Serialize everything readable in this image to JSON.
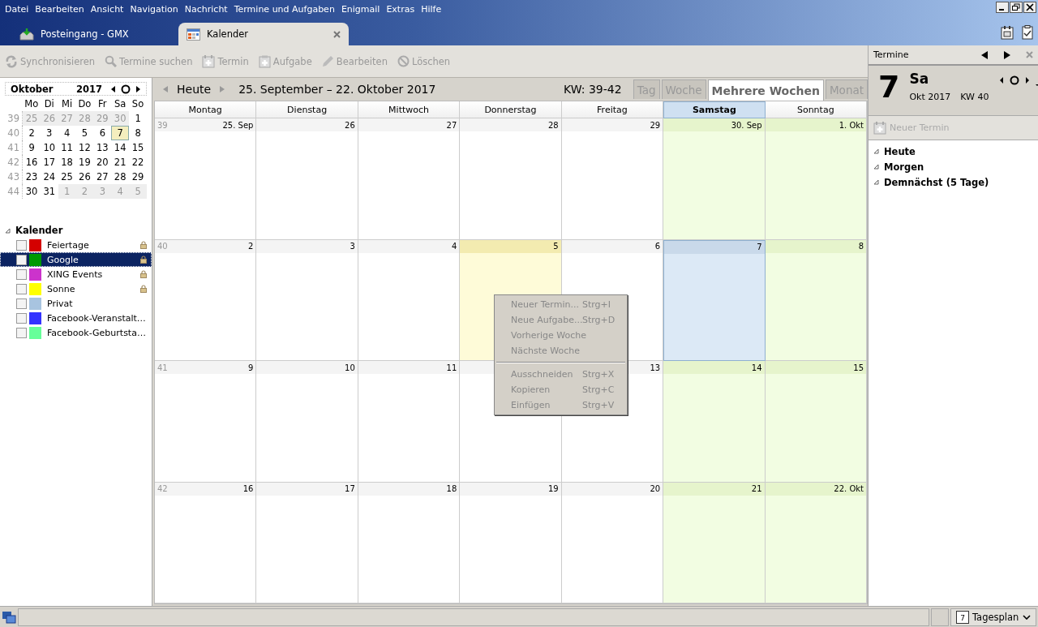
{
  "menu_bar": [
    "Datei",
    "Bearbeiten",
    "Ansicht",
    "Navigation",
    "Nachricht",
    "Termine und Aufgaben",
    "Enigmail",
    "Extras",
    "Hilfe"
  ],
  "app_tabs": [
    {
      "label": "Posteingang - GMX",
      "kind": "mail",
      "selected": false,
      "closable": false
    },
    {
      "label": "Kalender",
      "kind": "calendar",
      "selected": true,
      "closable": true
    }
  ],
  "toolbar": [
    {
      "label": "Synchronisieren",
      "kind": "sync",
      "disabled": true
    },
    {
      "label": "Termine suchen",
      "kind": "search",
      "disabled": true
    },
    {
      "label": "Termin",
      "kind": "event",
      "disabled": true
    },
    {
      "label": "Aufgabe",
      "kind": "task",
      "disabled": true
    },
    {
      "label": "Bearbeiten",
      "kind": "edit",
      "disabled": true
    },
    {
      "label": "Löschen",
      "kind": "delete",
      "disabled": true
    }
  ],
  "mini_calendar": {
    "month": "Oktober",
    "year": "2017",
    "weekdays": [
      "Mo",
      "Di",
      "Mi",
      "Do",
      "Fr",
      "Sa",
      "So"
    ],
    "weeks": [
      {
        "number": "39",
        "days": [
          {
            "label": "25",
            "other_month": true,
            "selected": false
          },
          {
            "label": "26",
            "other_month": true,
            "selected": false
          },
          {
            "label": "27",
            "other_month": true,
            "selected": false
          },
          {
            "label": "28",
            "other_month": true,
            "selected": false
          },
          {
            "label": "29",
            "other_month": true,
            "selected": false
          },
          {
            "label": "30",
            "other_month": true,
            "selected": false
          },
          {
            "label": "1",
            "other_month": false,
            "selected": false
          }
        ]
      },
      {
        "number": "40",
        "days": [
          {
            "label": "2",
            "other_month": false,
            "selected": false
          },
          {
            "label": "3",
            "other_month": false,
            "selected": false
          },
          {
            "label": "4",
            "other_month": false,
            "selected": false
          },
          {
            "label": "5",
            "other_month": false,
            "selected": false
          },
          {
            "label": "6",
            "other_month": false,
            "selected": false
          },
          {
            "label": "7",
            "other_month": false,
            "selected": true
          },
          {
            "label": "8",
            "other_month": false,
            "selected": false
          }
        ]
      },
      {
        "number": "41",
        "days": [
          {
            "label": "9",
            "other_month": false,
            "selected": false
          },
          {
            "label": "10",
            "other_month": false,
            "selected": false
          },
          {
            "label": "11",
            "other_month": false,
            "selected": false
          },
          {
            "label": "12",
            "other_month": false,
            "selected": false
          },
          {
            "label": "13",
            "other_month": false,
            "selected": false
          },
          {
            "label": "14",
            "other_month": false,
            "selected": false
          },
          {
            "label": "15",
            "other_month": false,
            "selected": false
          }
        ]
      },
      {
        "number": "42",
        "days": [
          {
            "label": "16",
            "other_month": false,
            "selected": false
          },
          {
            "label": "17",
            "other_month": false,
            "selected": false
          },
          {
            "label": "18",
            "other_month": false,
            "selected": false
          },
          {
            "label": "19",
            "other_month": false,
            "selected": false
          },
          {
            "label": "20",
            "other_month": false,
            "selected": false
          },
          {
            "label": "21",
            "other_month": false,
            "selected": false
          },
          {
            "label": "22",
            "other_month": false,
            "selected": false
          }
        ]
      },
      {
        "number": "43",
        "days": [
          {
            "label": "23",
            "other_month": false,
            "selected": false
          },
          {
            "label": "24",
            "other_month": false,
            "selected": false
          },
          {
            "label": "25",
            "other_month": false,
            "selected": false
          },
          {
            "label": "26",
            "other_month": false,
            "selected": false
          },
          {
            "label": "27",
            "other_month": false,
            "selected": false
          },
          {
            "label": "28",
            "other_month": false,
            "selected": false
          },
          {
            "label": "29",
            "other_month": false,
            "selected": false
          }
        ]
      },
      {
        "number": "44",
        "days": [
          {
            "label": "30",
            "other_month": false,
            "selected": false
          },
          {
            "label": "31",
            "other_month": false,
            "selected": false
          },
          {
            "label": "1",
            "other_month": true,
            "selected": false
          },
          {
            "label": "2",
            "other_month": true,
            "selected": false
          },
          {
            "label": "3",
            "other_month": true,
            "selected": false
          },
          {
            "label": "4",
            "other_month": true,
            "selected": false
          },
          {
            "label": "5",
            "other_month": true,
            "selected": false
          }
        ]
      }
    ]
  },
  "calendars": {
    "title": "Kalender",
    "expanded": true,
    "items": [
      {
        "name": "Feiertage",
        "color": "#d40000",
        "checked": false,
        "locked": true,
        "selected": false
      },
      {
        "name": "Google",
        "color": "#009900",
        "checked": false,
        "locked": true,
        "selected": true
      },
      {
        "name": "XING Events",
        "color": "#cc33cc",
        "checked": false,
        "locked": true,
        "selected": false
      },
      {
        "name": "Sonne",
        "color": "#ffff00",
        "checked": false,
        "locked": true,
        "selected": false
      },
      {
        "name": "Privat",
        "color": "#a8c4e0",
        "checked": false,
        "locked": false,
        "selected": false
      },
      {
        "name": "Facebook-Veranstalt…",
        "color": "#3333ff",
        "checked": false,
        "locked": false,
        "selected": false
      },
      {
        "name": "Facebook-Geburtsta…",
        "color": "#66ff99",
        "checked": false,
        "locked": false,
        "selected": false
      }
    ]
  },
  "view_header": {
    "today_button": "Heute",
    "range": "25. September – 22. Oktober 2017",
    "week_range": "KW: 39-42",
    "view_tabs": [
      {
        "label": "Tag",
        "selected": false
      },
      {
        "label": "Woche",
        "selected": false
      },
      {
        "label": "Mehrere Wochen",
        "selected": true
      },
      {
        "label": "Monat",
        "selected": false
      }
    ]
  },
  "day_columns": [
    {
      "label": "Montag",
      "selected": false
    },
    {
      "label": "Dienstag",
      "selected": false
    },
    {
      "label": "Mittwoch",
      "selected": false
    },
    {
      "label": "Donnerstag",
      "selected": false
    },
    {
      "label": "Freitag",
      "selected": false
    },
    {
      "label": "Samstag",
      "selected": true
    },
    {
      "label": "Sonntag",
      "selected": false
    }
  ],
  "weeks": [
    {
      "number": "39",
      "days": [
        {
          "label": "25. Sep",
          "weekend": false,
          "today": false,
          "selected": false
        },
        {
          "label": "26",
          "weekend": false,
          "today": false,
          "selected": false
        },
        {
          "label": "27",
          "weekend": false,
          "today": false,
          "selected": false
        },
        {
          "label": "28",
          "weekend": false,
          "today": false,
          "selected": false
        },
        {
          "label": "29",
          "weekend": false,
          "today": false,
          "selected": false
        },
        {
          "label": "30. Sep",
          "weekend": true,
          "today": false,
          "selected": false
        },
        {
          "label": "1. Okt",
          "weekend": true,
          "today": false,
          "selected": false
        }
      ]
    },
    {
      "number": "40",
      "days": [
        {
          "label": "2",
          "weekend": false,
          "today": false,
          "selected": false
        },
        {
          "label": "3",
          "weekend": false,
          "today": false,
          "selected": false
        },
        {
          "label": "4",
          "weekend": false,
          "today": false,
          "selected": false
        },
        {
          "label": "5",
          "weekend": false,
          "today": false,
          "selected": true
        },
        {
          "label": "6",
          "weekend": false,
          "today": false,
          "selected": false
        },
        {
          "label": "7",
          "weekend": true,
          "today": true,
          "selected": false
        },
        {
          "label": "8",
          "weekend": true,
          "today": false,
          "selected": false
        }
      ]
    },
    {
      "number": "41",
      "days": [
        {
          "label": "9",
          "weekend": false,
          "today": false,
          "selected": false
        },
        {
          "label": "10",
          "weekend": false,
          "today": false,
          "selected": false
        },
        {
          "label": "11",
          "weekend": false,
          "today": false,
          "selected": false
        },
        {
          "weekend": false,
          "today": false,
          "selected": false
        },
        {
          "label": "13",
          "weekend": false,
          "today": false,
          "selected": false
        },
        {
          "label": "14",
          "weekend": true,
          "today": false,
          "selected": false
        },
        {
          "label": "15",
          "weekend": true,
          "today": false,
          "selected": false
        }
      ]
    },
    {
      "number": "42",
      "days": [
        {
          "label": "16",
          "weekend": false,
          "today": false,
          "selected": false
        },
        {
          "label": "17",
          "weekend": false,
          "today": false,
          "selected": false
        },
        {
          "label": "18",
          "weekend": false,
          "today": false,
          "selected": false
        },
        {
          "label": "19",
          "weekend": false,
          "today": false,
          "selected": false
        },
        {
          "label": "20",
          "weekend": false,
          "today": false,
          "selected": false
        },
        {
          "label": "21",
          "weekend": true,
          "today": false,
          "selected": false
        },
        {
          "label": "22. Okt",
          "weekend": true,
          "today": false,
          "selected": false
        }
      ]
    }
  ],
  "context_menu": [
    {
      "kind": "item",
      "label": "Neuer Termin...",
      "shortcut": "Strg+I",
      "disabled": true
    },
    {
      "kind": "item",
      "label": "Neue Aufgabe...",
      "shortcut": "Strg+D",
      "disabled": true
    },
    {
      "kind": "item",
      "label": "Vorherige Woche",
      "disabled": true
    },
    {
      "kind": "item",
      "label": "Nächste Woche",
      "disabled": true
    },
    {
      "kind": "separator"
    },
    {
      "kind": "item",
      "label": "Ausschneiden",
      "shortcut": "Strg+X",
      "disabled": true
    },
    {
      "kind": "item",
      "label": "Kopieren",
      "shortcut": "Strg+C",
      "disabled": true
    },
    {
      "kind": "item",
      "label": "Einfügen",
      "shortcut": "Strg+V",
      "disabled": true
    }
  ],
  "today_pane": {
    "title": "Termine",
    "day": "7",
    "weekday": "Sa",
    "month_year": "Okt 2017",
    "week": "KW 40",
    "new_event": {
      "label": "Neuer Termin",
      "disabled": true
    },
    "groups": [
      {
        "label": "Heute",
        "expanded": true
      },
      {
        "label": "Morgen",
        "expanded": true
      },
      {
        "label": "Demnächst (5 Tage)",
        "expanded": true
      }
    ]
  },
  "status_bar": {
    "day_plan": "Tagesplan",
    "day_icon": "7"
  }
}
